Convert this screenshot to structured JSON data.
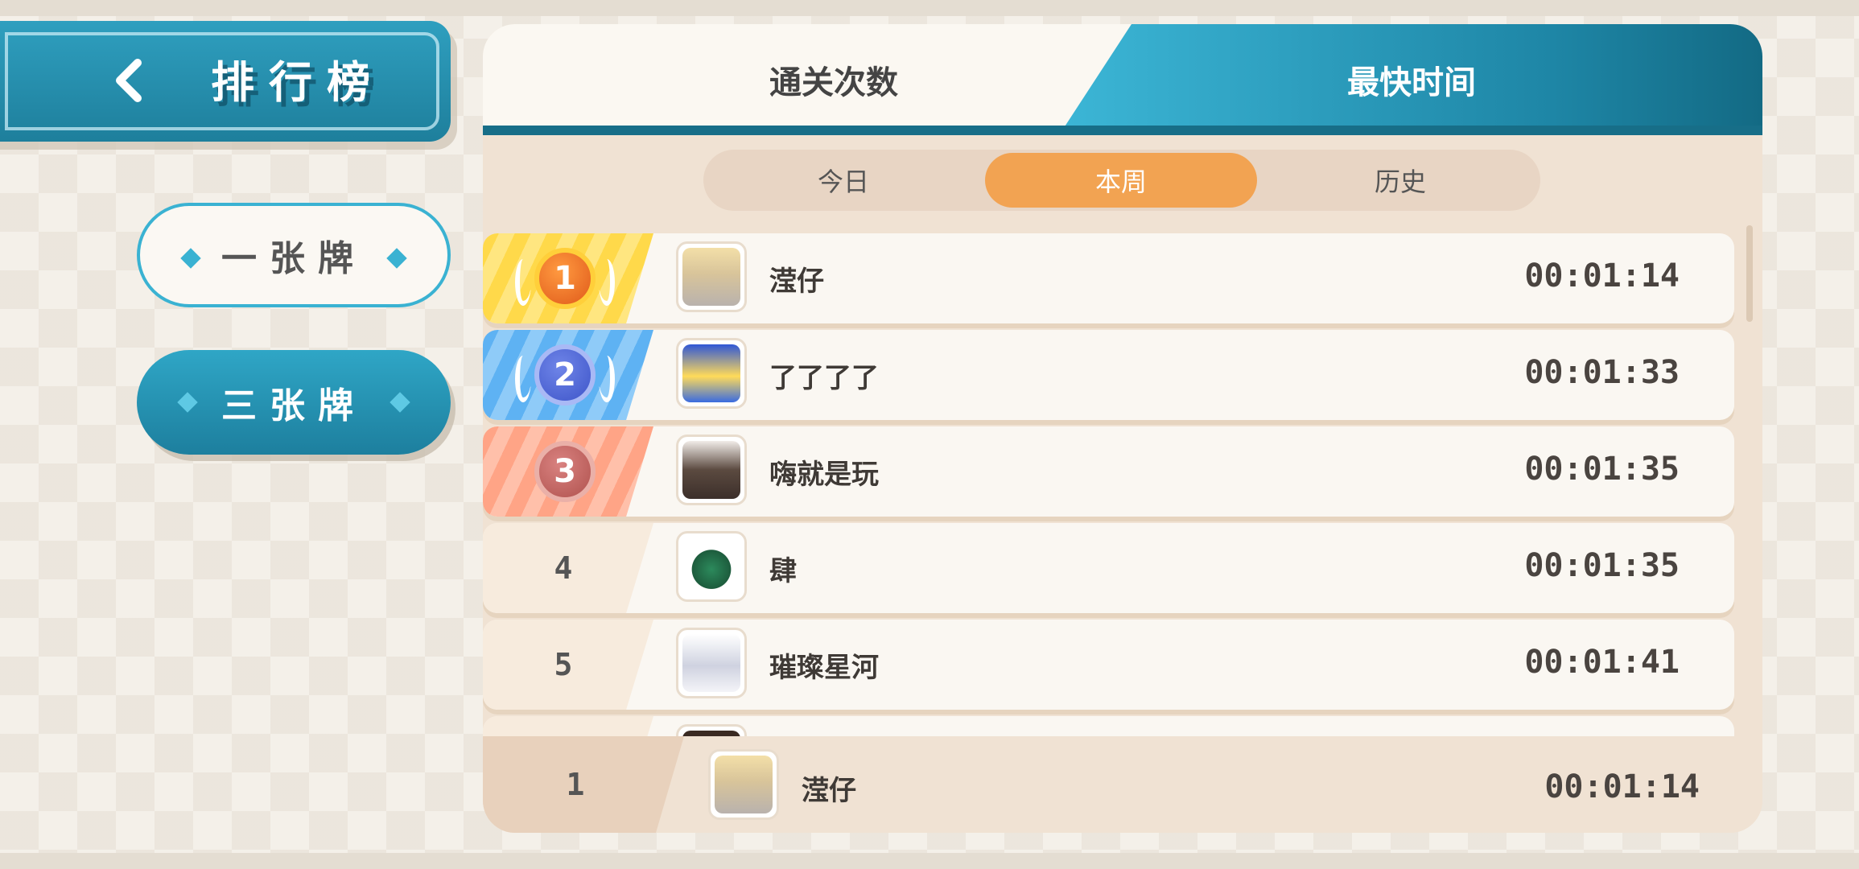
{
  "header": {
    "title": "排行榜",
    "back_icon": "chevron-left-icon"
  },
  "modes": [
    {
      "label": "一张牌",
      "selected": false
    },
    {
      "label": "三张牌",
      "selected": true
    }
  ],
  "tabs": [
    {
      "label": "通关次数",
      "selected": false
    },
    {
      "label": "最快时间",
      "selected": true
    }
  ],
  "periods": [
    {
      "label": "今日",
      "selected": false
    },
    {
      "label": "本周",
      "selected": true
    },
    {
      "label": "历史",
      "selected": false
    }
  ],
  "leaderboard": [
    {
      "rank": "1",
      "name": "滢仔",
      "time": "00:01:14",
      "medal": "gold"
    },
    {
      "rank": "2",
      "name": "了了了了",
      "time": "00:01:33",
      "medal": "silver"
    },
    {
      "rank": "3",
      "name": "嗨就是玩",
      "time": "00:01:35",
      "medal": "bronze"
    },
    {
      "rank": "4",
      "name": "肆",
      "time": "00:01:35"
    },
    {
      "rank": "5",
      "name": "璀璨星河",
      "time": "00:01:41"
    }
  ],
  "my_rank": {
    "rank": "1",
    "name": "滢仔",
    "time": "00:01:14"
  },
  "colors": {
    "accent_teal": "#1e86a6",
    "accent_orange": "#f2a352",
    "panel_bg": "#f0e2d3"
  }
}
